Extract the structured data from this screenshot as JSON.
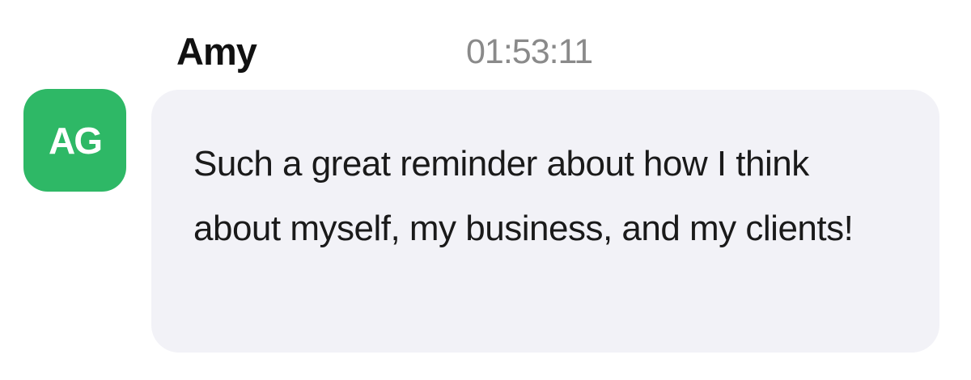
{
  "message": {
    "sender_name": "Amy",
    "timestamp": "01:53:11",
    "avatar": {
      "initials": "AG",
      "color": "#2eb866"
    },
    "text": "Such a great reminder about how I think about myself, my business, and my clients!"
  },
  "colors": {
    "bubble_background": "#f2f2f7",
    "timestamp": "#8a8a8a"
  }
}
